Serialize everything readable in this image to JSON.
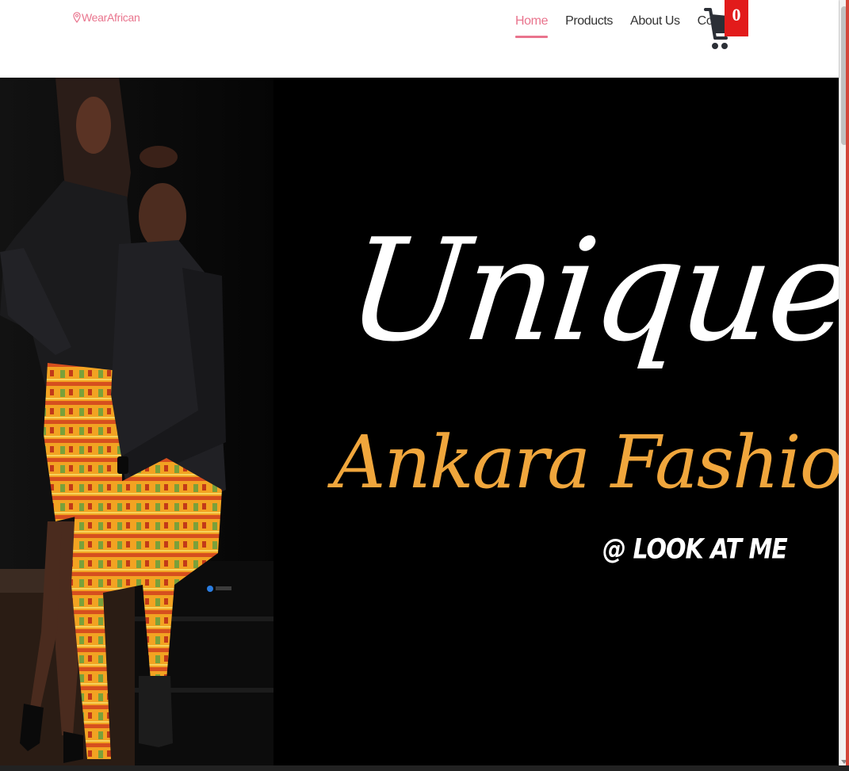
{
  "navbar": {
    "brand": "WearAfrican",
    "links": [
      {
        "label": "Home",
        "active": true
      },
      {
        "label": "Products",
        "active": false
      },
      {
        "label": "About Us",
        "active": false
      },
      {
        "label": "Contact",
        "active": false
      }
    ],
    "cart_count": "0",
    "accent_color": "#e9748d",
    "badge_color": "#e21b1b"
  },
  "hero": {
    "headline": "Unique",
    "subheadline": "Ankara Fashion",
    "tagline": "@ LOOK AT ME",
    "headline_color": "#ffffff",
    "subheadline_color": "#f0a63c",
    "background_color": "#000000",
    "image_description_icon": "couple-photo"
  }
}
